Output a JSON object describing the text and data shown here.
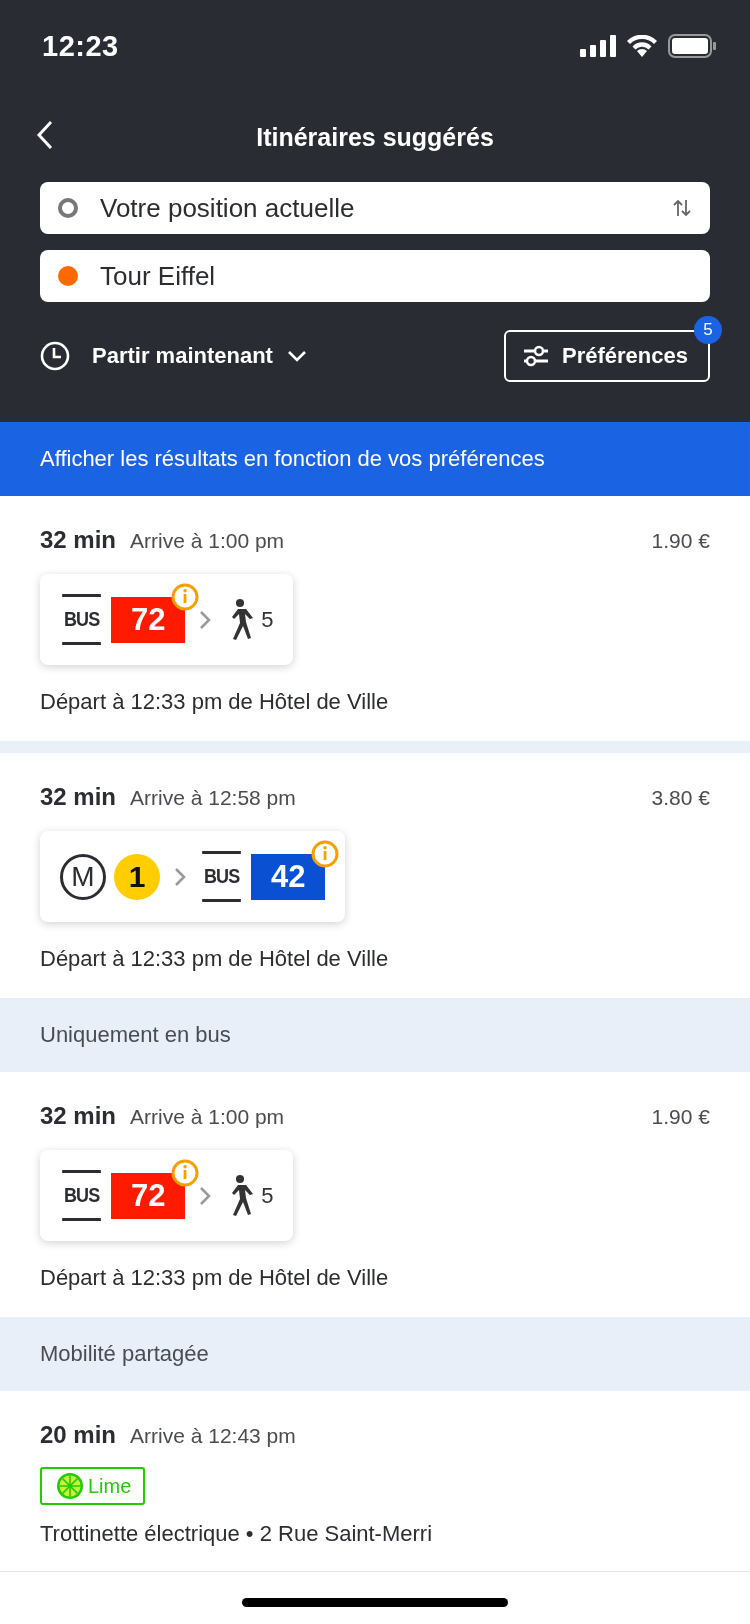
{
  "status_bar": {
    "time": "12:23"
  },
  "header": {
    "title": "Itinéraires suggérés",
    "origin": "Votre position actuelle",
    "destination": "Tour Eiffel",
    "departure": "Partir maintenant",
    "preferences": {
      "label": "Préférences",
      "badge": "5"
    }
  },
  "banner": "Afficher les résultats en fonction de vos préférences",
  "items": [
    {
      "kind": "route",
      "duration": "32 min",
      "arrival": "Arrive à 1:00 pm",
      "price": "1.90 €",
      "legs": [
        {
          "kind": "bus",
          "mode_label": "BUS",
          "line": "72",
          "color": "#ff1a00",
          "alert": true
        },
        {
          "kind": "walk",
          "minutes": "5"
        }
      ],
      "details": "Départ à 12:33 pm de Hôtel de Ville"
    },
    {
      "kind": "gap"
    },
    {
      "kind": "route",
      "duration": "32 min",
      "arrival": "Arrive à 12:58 pm",
      "price": "3.80 €",
      "legs": [
        {
          "kind": "metro",
          "mode_label": "M",
          "line": "1",
          "color": "#ffcd00",
          "alert": false
        },
        {
          "kind": "bus",
          "mode_label": "BUS",
          "line": "42",
          "color": "#0a50d2",
          "alert": true
        }
      ],
      "details": "Départ à 12:33 pm de Hôtel de Ville"
    },
    {
      "kind": "section",
      "title": "Uniquement en bus"
    },
    {
      "kind": "route",
      "duration": "32 min",
      "arrival": "Arrive à 1:00 pm",
      "price": "1.90 €",
      "legs": [
        {
          "kind": "bus",
          "mode_label": "BUS",
          "line": "72",
          "color": "#ff1a00",
          "alert": true
        },
        {
          "kind": "walk",
          "minutes": "5"
        }
      ],
      "details": "Départ à 12:33 pm de Hôtel de Ville"
    },
    {
      "kind": "section",
      "title": "Mobilité partagée"
    },
    {
      "kind": "shared",
      "duration": "20 min",
      "arrival": "Arrive à 12:43 pm",
      "provider": "Lime",
      "details": "Trottinette électrique • 2 Rue Saint-Merri"
    }
  ]
}
